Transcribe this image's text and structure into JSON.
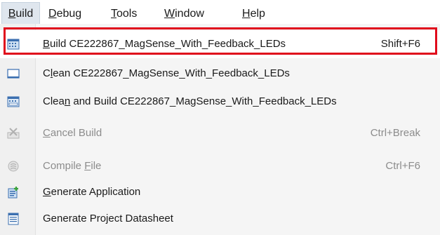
{
  "menubar": {
    "items": [
      {
        "pre": "",
        "mn": "B",
        "post": "uild"
      },
      {
        "pre": "",
        "mn": "D",
        "post": "ebug"
      },
      {
        "pre": "",
        "mn": "T",
        "post": "ools"
      },
      {
        "pre": "",
        "mn": "W",
        "post": "indow"
      },
      {
        "pre": "",
        "mn": "H",
        "post": "elp"
      }
    ]
  },
  "build_menu": {
    "items": [
      {
        "pre": "",
        "mn": "B",
        "post": "uild CE222867_MagSense_With_Feedback_LEDs",
        "shortcut": "Shift+F6",
        "icon": "build-icon",
        "enabled": true,
        "highlighted": true
      },
      {
        "pre": "C",
        "mn": "l",
        "post": "ean CE222867_MagSense_With_Feedback_LEDs",
        "shortcut": "",
        "icon": "clean-icon",
        "enabled": true,
        "highlighted": false
      },
      {
        "pre": "Clea",
        "mn": "n",
        "post": " and Build CE222867_MagSense_With_Feedback_LEDs",
        "shortcut": "",
        "icon": "clean-build-icon",
        "enabled": true,
        "highlighted": false
      },
      {
        "pre": "",
        "mn": "C",
        "post": "ancel Build",
        "shortcut": "Ctrl+Break",
        "icon": "cancel-build-icon",
        "enabled": false,
        "highlighted": false
      },
      {
        "pre": "Compile ",
        "mn": "F",
        "post": "ile",
        "shortcut": "Ctrl+F6",
        "icon": "compile-file-icon",
        "enabled": false,
        "highlighted": false
      },
      {
        "pre": "",
        "mn": "G",
        "post": "enerate Application",
        "shortcut": "",
        "icon": "generate-application-icon",
        "enabled": true,
        "highlighted": false
      },
      {
        "pre": "Generate Project Datasheet",
        "mn": "",
        "post": "",
        "shortcut": "",
        "icon": "datasheet-icon",
        "enabled": true,
        "highlighted": false
      }
    ]
  },
  "colors": {
    "highlight_border": "#e00b1c",
    "menu_active_bg": "#dfe6ee",
    "disabled_text": "#8c8c8c"
  }
}
